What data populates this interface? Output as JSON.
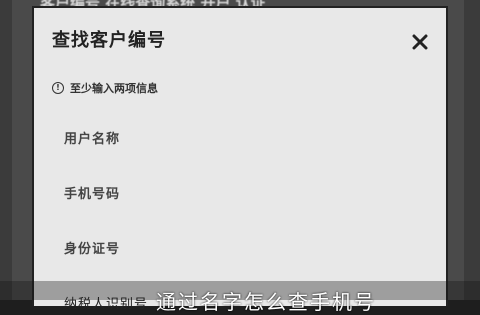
{
  "background": {
    "text": "客户编号 在线查询系统 开户 认证"
  },
  "dialog": {
    "title": "查找客户编号",
    "close_icon": "close-icon",
    "hint": "至少输入两项信息",
    "fields": [
      {
        "label": "用户名称"
      },
      {
        "label": "手机号码"
      },
      {
        "label": "身份证号"
      },
      {
        "label": "纳税人识别号"
      }
    ]
  },
  "subtitle": {
    "text": "通过名字怎么查手机号"
  },
  "colors": {
    "dialog_bg": "#e8e8e8",
    "backdrop": "#4a4a4a",
    "text_dark": "#222222"
  }
}
